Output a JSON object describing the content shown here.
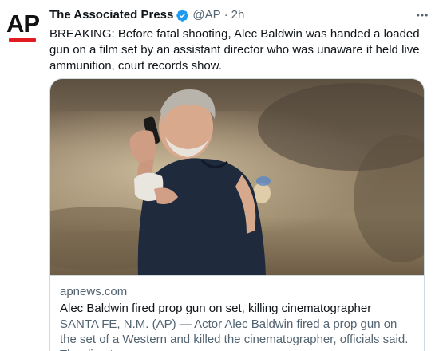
{
  "tweet": {
    "avatar_text": "AP",
    "display_name": "The Associated Press",
    "handle": "@AP",
    "separator": "·",
    "time": "2h",
    "text": "BREAKING: Before fatal shooting, Alec Baldwin was handed a loaded gun on a film set by an assistant director who was unaware it held live ammunition, court records show."
  },
  "card": {
    "domain": "apnews.com",
    "title": "Alec Baldwin fired prop gun on set, killing cinematographer",
    "description": "SANTA FE, N.M. (AP) — Actor Alec Baldwin fired a prop gun on the set of a Western and killed the cinematographer, officials said. The direct..."
  },
  "icons": {
    "verified": "verified-badge-icon",
    "more": "more-options-icon"
  },
  "colors": {
    "ap_red": "#e21b22",
    "verified_blue": "#1d9bf0",
    "secondary_text": "#536471",
    "card_border": "#cfd9de"
  }
}
